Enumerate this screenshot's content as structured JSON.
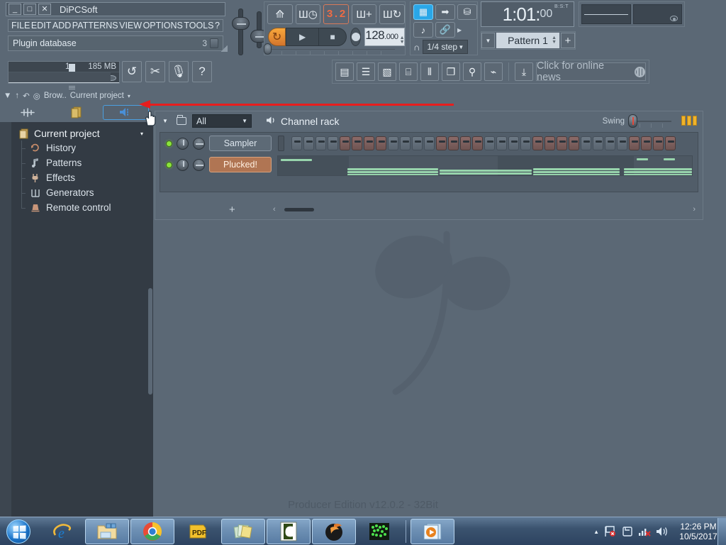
{
  "window": {
    "title": "DiPCSoft",
    "buttons": [
      {
        "name": "minimize",
        "label": "_"
      },
      {
        "name": "maximize",
        "label": "□"
      },
      {
        "name": "close",
        "label": "✕"
      }
    ]
  },
  "menu": {
    "items": [
      "FILE",
      "EDIT",
      "ADD",
      "PATTERNS",
      "VIEW",
      "OPTIONS",
      "TOOLS",
      "?"
    ]
  },
  "plugin_db": {
    "label": "Plugin database",
    "count": "3"
  },
  "meters": {
    "cpu": "1",
    "memory": "185 MB",
    "disk": "0"
  },
  "tools": [
    {
      "name": "undo-history-button",
      "glyph": "↺"
    },
    {
      "name": "cut-tool-button",
      "glyph": "✂"
    },
    {
      "name": "microphone-button",
      "glyph": "🎙"
    },
    {
      "name": "help-button",
      "glyph": "?"
    }
  ],
  "transport": {
    "top_buttons": [
      {
        "name": "metronome-button",
        "glyph": "⟰"
      },
      {
        "name": "wait-for-input-button",
        "glyph": "Ш◷"
      },
      {
        "name": "pattern-length-display",
        "glyph": "3.2"
      },
      {
        "name": "countdown-button",
        "glyph": "Ш+"
      },
      {
        "name": "loop-record-button",
        "glyph": "Ш↻"
      }
    ],
    "loop_mode": "↻",
    "play": "▶",
    "stop": "■",
    "record": "●",
    "tempo_whole": "128",
    "tempo_decimal": ".000"
  },
  "snap": {
    "buttons": [
      {
        "name": "typing-keyboard-button",
        "glyph": "▦"
      },
      {
        "name": "multi-link-button",
        "glyph": "➡"
      },
      {
        "name": "knob-button",
        "glyph": "⛁"
      },
      {
        "name": "step-edit-button",
        "glyph": "♪"
      },
      {
        "name": "link-button",
        "glyph": "🔗"
      }
    ],
    "headphone_icon": "∩",
    "snap_value": "1/4 step"
  },
  "time_display": {
    "value_main": "1:01",
    "value_sub": "00",
    "unit": "B:S:T"
  },
  "pattern_selector": {
    "dropdown": "▼",
    "name": "Pattern 1",
    "plus": "+"
  },
  "shortcuts": {
    "buttons": [
      {
        "name": "playlist-button",
        "glyph": "▤"
      },
      {
        "name": "channel-rack-button",
        "glyph": "☰"
      },
      {
        "name": "piano-roll-button",
        "glyph": "▧"
      },
      {
        "name": "browser-button",
        "glyph": "⌸"
      },
      {
        "name": "mixer-button",
        "glyph": "⫴"
      },
      {
        "name": "project-picker-button",
        "glyph": "❐"
      },
      {
        "name": "plugin-picker-button",
        "glyph": "⚲"
      },
      {
        "name": "tempo-tap-button",
        "glyph": "⌁"
      }
    ],
    "download_glyph": "⤓",
    "news_text": "Click for online news"
  },
  "browser": {
    "header": {
      "sort": "▼",
      "up": "↑",
      "undo": "↶",
      "search": "◎",
      "label": "Brow..",
      "project": "Current project",
      "chevron": "▾"
    },
    "tabs": [
      {
        "name": "waveform-tab",
        "glyph": "⌁"
      },
      {
        "name": "files-tab",
        "glyph": "📄"
      },
      {
        "name": "audio-tab",
        "glyph": "🔊"
      }
    ],
    "tree_root": {
      "label": "Current project",
      "icon": "📄",
      "chevron": "▾"
    },
    "tree_items": [
      {
        "label": "History",
        "icon": "⟳"
      },
      {
        "label": "Patterns",
        "icon": "♪"
      },
      {
        "label": "Effects",
        "icon": "⚲"
      },
      {
        "label": "Generators",
        "icon": "Ш"
      },
      {
        "label": "Remote control",
        "icon": "⛁"
      }
    ]
  },
  "channel_rack": {
    "title": "Channel rack",
    "speaker_icon": "🔊",
    "dropdown": "▼",
    "folder_icon": "folder-icon",
    "filter_value": "All",
    "swing_label": "Swing",
    "grid_icon": "grid-icon",
    "channels": [
      {
        "name": "Sampler",
        "color": "gray",
        "led": "on",
        "selected_led": "dim"
      },
      {
        "name": "Plucked!",
        "color": "brown",
        "led": "on",
        "selected_led": "lit"
      }
    ],
    "step_count": 32,
    "step_group_size": 4,
    "add_channel": "+",
    "scroll_left": "‹",
    "scroll_right": "›"
  },
  "desktop": {
    "edition_text": "Producer Edition v12.0.2 - 32Bit"
  },
  "taskbar": {
    "items": [
      {
        "name": "internet-explorer",
        "glyph": "e"
      },
      {
        "name": "file-explorer",
        "glyph": "🗂"
      },
      {
        "name": "google-chrome",
        "glyph": "◉"
      },
      {
        "name": "pdf-reader",
        "glyph": "PDF"
      },
      {
        "name": "sticky-notes",
        "glyph": "▤"
      },
      {
        "name": "c-app",
        "glyph": "C"
      },
      {
        "name": "fl-studio",
        "glyph": "◍"
      },
      {
        "name": "green-dots-app",
        "glyph": "⣿"
      },
      {
        "name": "media-player",
        "glyph": "▶"
      }
    ],
    "tray": {
      "expand": "▲",
      "flag": "⚑",
      "action_center": "🗔",
      "network": "📶",
      "volume": "🔊",
      "time": "12:26 PM",
      "date": "10/5/2017"
    }
  },
  "colors": {
    "accent_blue": "#4b9fe0",
    "channel_brown": "#b07553",
    "led_green": "#8ae33c",
    "annotation_red": "#e81d1d",
    "tempo_orange": "#ef6b44",
    "note_green": "#97d4ac"
  }
}
